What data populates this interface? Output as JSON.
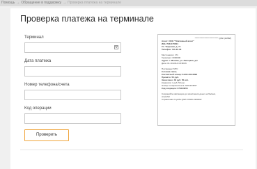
{
  "breadcrumb": {
    "items": [
      "Помощь",
      "Обращение в поддержку",
      "Проверка платежа на терминале"
    ]
  },
  "page": {
    "title": "Проверка платежа на терминале"
  },
  "form": {
    "terminal_label": "Терминал",
    "terminal_value": "",
    "date_label": "Дата платежа",
    "date_value": "",
    "phone_label": "Номер телефона/счета",
    "phone_value": "",
    "code_label": "Код операции",
    "code_value": "",
    "submit_label": "Проверить"
  },
  "receipt": {
    "header": "***************************** QIWI (КИВИ)",
    "lines_1": [
      "Агент: ООО \"Платежный агент\"",
      "ИНН 7234175601",
      "Ул. Тверская, д. 71",
      "Телефон: 111-22-33"
    ],
    "lines_2": [
      "Местонахож: 171",
      "Терминал: 0000000",
      "Адрес: г. Москва, ул. Липецкая, д.5",
      "Дата: 01.10.2014 18:38:06"
    ],
    "lines_3": [
      "Поставщик: МТС",
      "Сотовая связь",
      "Контактный номер: 8-800-333-0890",
      "Принято: 50 руб.",
      "Зачислено: 49 руб. 50 коп.",
      "Комиссия: 1 руб. 50 коп.",
      "Номер телефона/счета: 9161234567",
      "Код операции: 276434856"
    ],
    "lines_4": [
      "Сохраняйте квитанцию до зачисления денег на баланс,",
      "спасибо!",
      "Справочная служба QIWI: 8-800-3330202"
    ]
  },
  "icons": {
    "calendar": "calendar-icon"
  },
  "colors": {
    "accent": "#f0a43a",
    "background": "#f0f0f0",
    "panel": "#ffffff"
  }
}
